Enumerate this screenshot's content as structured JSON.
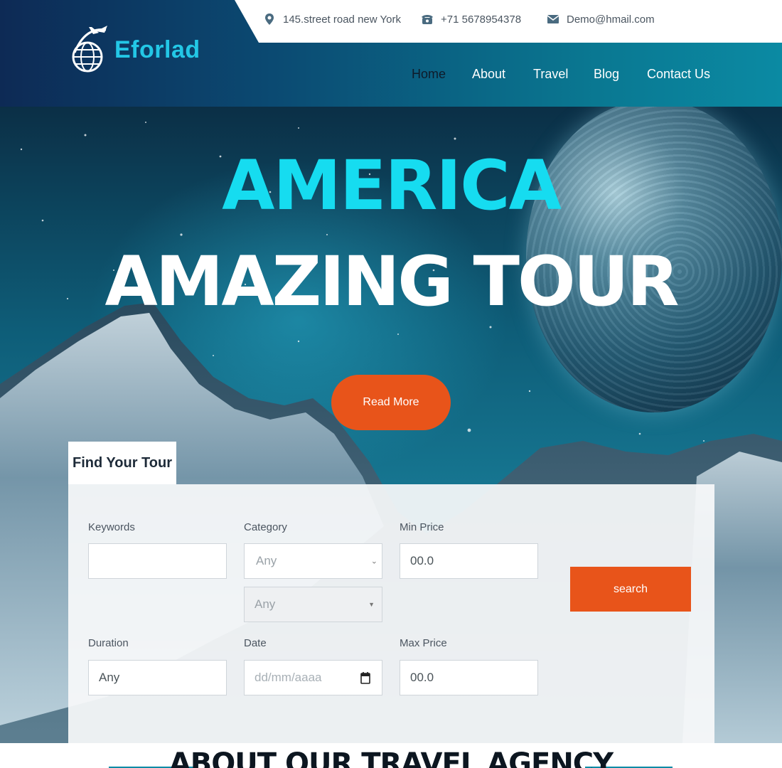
{
  "brand": {
    "name": "Eforlad",
    "logo_icon": "airplane-globe-icon"
  },
  "topbar": {
    "address": "145.street road new York",
    "phone": "+71 5678954378",
    "email": "Demo@hmail.com"
  },
  "nav": {
    "items": [
      {
        "label": "Home",
        "active": true
      },
      {
        "label": "About"
      },
      {
        "label": "Travel"
      },
      {
        "label": "Blog"
      },
      {
        "label": "Contact Us"
      }
    ]
  },
  "hero": {
    "title_line1": "AMERICA",
    "title_line2": "AMAZING TOUR",
    "cta_label": "Read More"
  },
  "search": {
    "tab_label": "Find Your Tour",
    "keywords_label": "Keywords",
    "keywords_value": "",
    "category_label": "Category",
    "category_value": "Any",
    "subcategory_value": "Any",
    "min_price_label": "Min Price",
    "min_price_value": "00.0",
    "duration_label": "Duration",
    "duration_value": "Any",
    "date_label": "Date",
    "date_placeholder": "dd/mm/aaaa",
    "max_price_label": "Max Price",
    "max_price_value": "00.0",
    "button_label": "search"
  },
  "about": {
    "title": "ABOUT OUR TRAVEL AGENCY"
  },
  "colors": {
    "accent": "#e8541a",
    "brand": "#23c7e6",
    "hero_title": "#16dcf0"
  }
}
